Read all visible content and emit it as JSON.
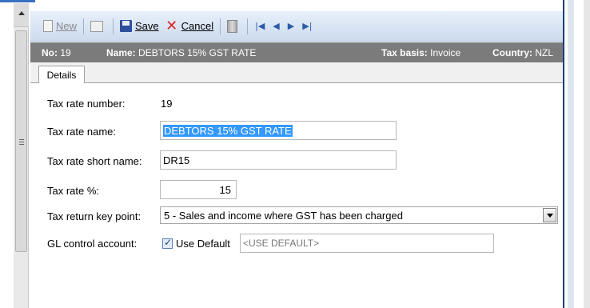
{
  "toolbar": {
    "new_label": "New",
    "save_label": "Save",
    "cancel_label": "Cancel",
    "nav_first": "|◀",
    "nav_prev": "◀",
    "nav_next": "▶",
    "nav_last": "▶|"
  },
  "header": {
    "no_label": "No:",
    "no_value": "19",
    "name_label": "Name:",
    "name_value": "DEBTORS 15% GST RATE",
    "tax_basis_label": "Tax basis:",
    "tax_basis_value": "Invoice",
    "country_label": "Country:",
    "country_value": "NZL"
  },
  "tabs": [
    {
      "label": "Details"
    }
  ],
  "form": {
    "tax_rate_number_label": "Tax rate number:",
    "tax_rate_number_value": "19",
    "tax_rate_name_label": "Tax rate name:",
    "tax_rate_name_value": "DEBTORS 15% GST RATE",
    "tax_rate_short_name_label": "Tax rate short name:",
    "tax_rate_short_name_value": "DR15",
    "tax_rate_percent_label": "Tax rate %:",
    "tax_rate_percent_value": "15",
    "tax_return_key_point_label": "Tax return key point:",
    "tax_return_key_point_value": "5 - Sales and income where GST has been charged",
    "gl_control_account_label": "GL control account:",
    "use_default_label": "Use Default",
    "use_default_checked": true,
    "gl_control_account_placeholder": "<USE DEFAULT>"
  },
  "colors": {
    "header_bg": "#7b7b7b",
    "selection": "#3399ff",
    "accent": "#3a6fc1"
  }
}
